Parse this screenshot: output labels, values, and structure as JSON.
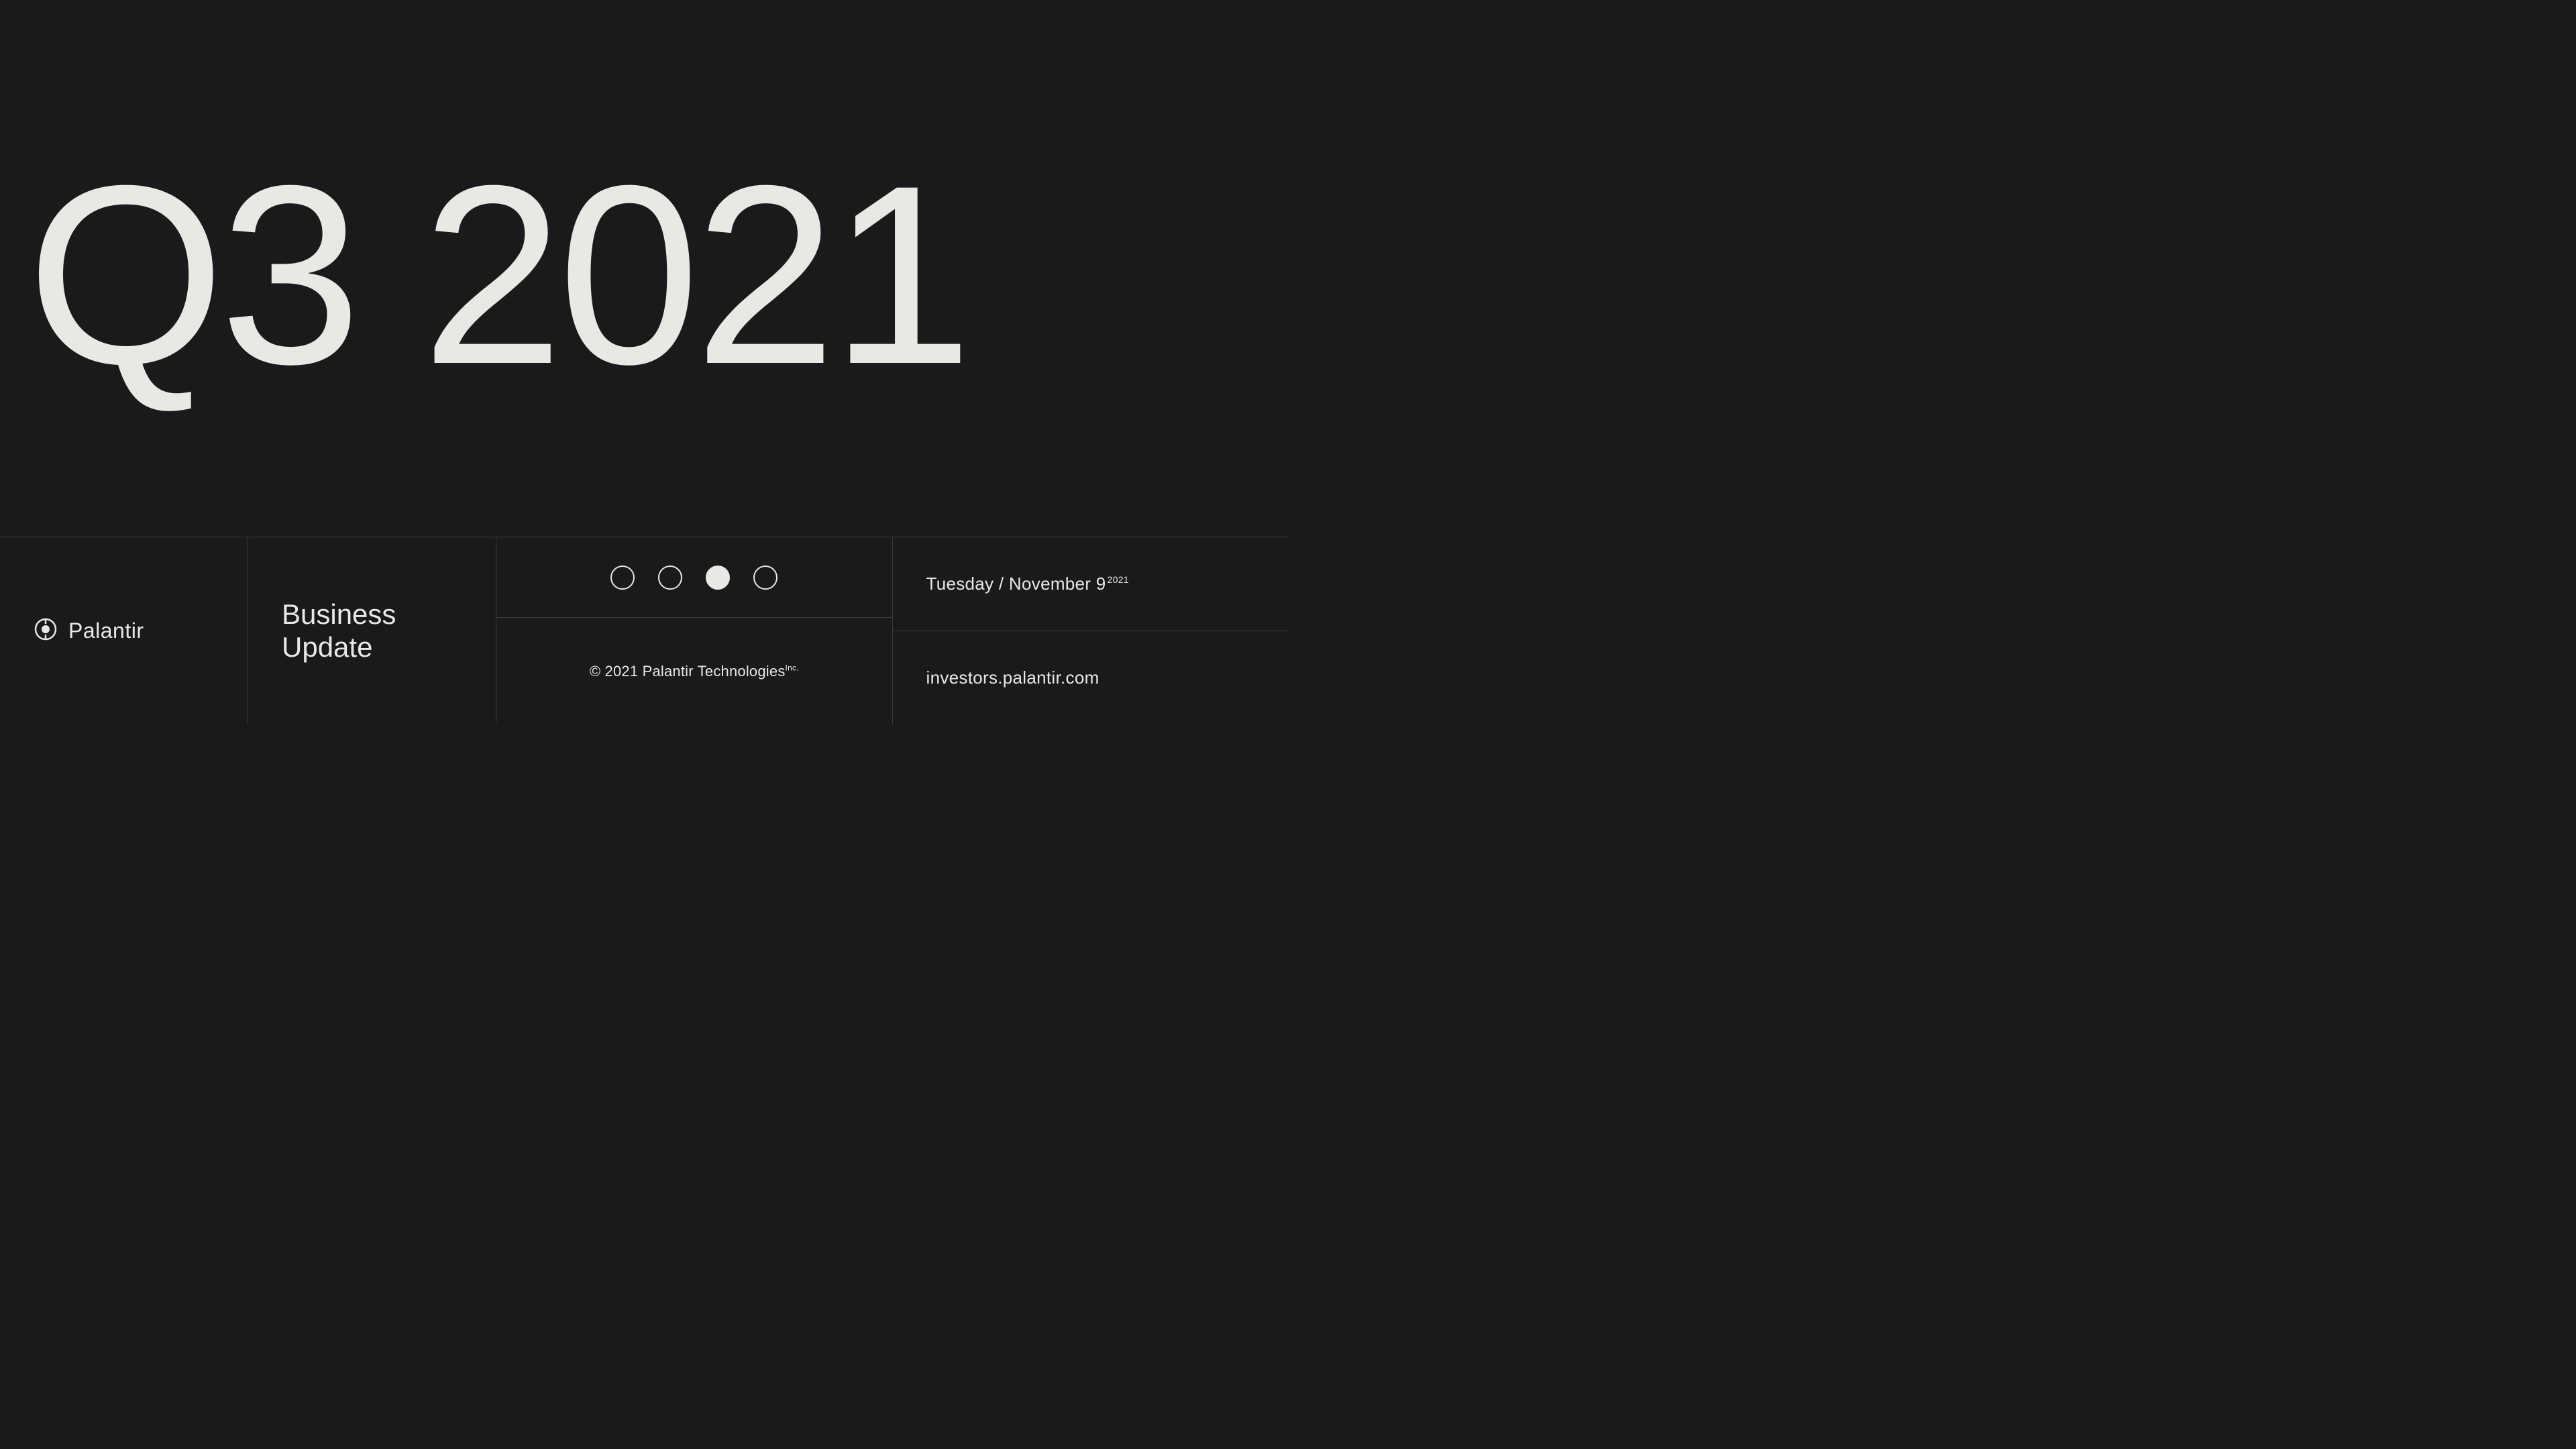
{
  "hero": {
    "title": "Q3 2021"
  },
  "footer": {
    "logo": {
      "name": "Palantir",
      "icon_label": "palantir-icon"
    },
    "business_update_line1": "Business",
    "business_update_line2": "Update",
    "dots": [
      {
        "filled": false,
        "index": 0
      },
      {
        "filled": false,
        "index": 1
      },
      {
        "filled": true,
        "index": 2
      },
      {
        "filled": false,
        "index": 3
      }
    ],
    "date_label": "Tuesday / November 9",
    "date_year": "2021",
    "copyright_text": "© 2021 Palantir Technologies",
    "copyright_suffix": "Inc.",
    "investors_url": "investors.palantir.com"
  }
}
